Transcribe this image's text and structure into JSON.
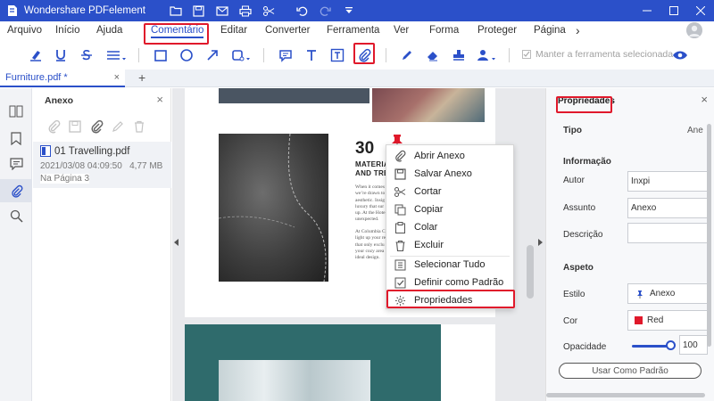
{
  "app": {
    "title": "Wondershare PDFelement"
  },
  "menu": {
    "items": [
      "Arquivo",
      "Início",
      "Ajuda",
      "Comentário",
      "Editar",
      "Converter",
      "Ferramenta",
      "Ver",
      "Forma",
      "Proteger",
      "Página"
    ],
    "active": "Comentário",
    "more": "›"
  },
  "toolbar": {
    "keep_tool_label": "Manter a ferramenta selecionada",
    "selected_tool": "attach-file-icon"
  },
  "tabs": {
    "document": "Furniture.pdf *",
    "close": "×",
    "add": "+"
  },
  "annex_panel": {
    "title": "Anexo",
    "close": "×",
    "file": {
      "name": "01 Travelling.pdf",
      "date": "2021/03/08 04:09:50",
      "size": "4,77 MB",
      "page": "Na Página 3"
    }
  },
  "document": {
    "heading_number": "30",
    "heading_line1": "MATERIA",
    "heading_line2": "AND TRE",
    "para1": [
      "When it comes",
      "we’re drawn to",
      "aesthetic. Insig",
      "luxury that sur",
      "up. At the Hote",
      "unexpected."
    ],
    "para2": [
      "At Columbia C",
      "light up your re",
      "that only exclu",
      "your cozy area",
      "ideal design."
    ]
  },
  "context_menu": {
    "items": [
      {
        "label": "Abrir Anexo",
        "icon": "open-attachment-icon"
      },
      {
        "label": "Salvar Anexo",
        "icon": "save-attachment-icon"
      },
      {
        "label": "Cortar",
        "icon": "cut-icon"
      },
      {
        "label": "Copiar",
        "icon": "copy-icon"
      },
      {
        "label": "Colar",
        "icon": "paste-icon"
      },
      {
        "label": "Excluir",
        "icon": "delete-icon"
      },
      {
        "label": "Selecionar Tudo",
        "icon": "select-all-icon"
      },
      {
        "label": "Definir como Padrão",
        "icon": "set-default-icon"
      },
      {
        "label": "Propriedades",
        "icon": "properties-icon"
      }
    ],
    "highlighted": "Propriedades"
  },
  "properties": {
    "title": "Propriedades",
    "close": "×",
    "type_label": "Tipo",
    "type_value": "Ane",
    "info_section": "Informação",
    "author_label": "Autor",
    "author_value": "Inxpi",
    "subject_label": "Assunto",
    "subject_value": "Anexo",
    "description_label": "Descrição",
    "description_value": "",
    "aspect_section": "Aspeto",
    "style_label": "Estilo",
    "style_value": "Anexo",
    "color_label": "Cor",
    "color_value": "Red",
    "color_swatch": "#e0192b",
    "opacity_label": "Opacidade",
    "opacity_value": "100",
    "default_button": "Usar Como Padrão"
  },
  "colors": {
    "brand": "#2b50c9",
    "highlight": "#e0192b",
    "teal": "#2f6b6c"
  }
}
